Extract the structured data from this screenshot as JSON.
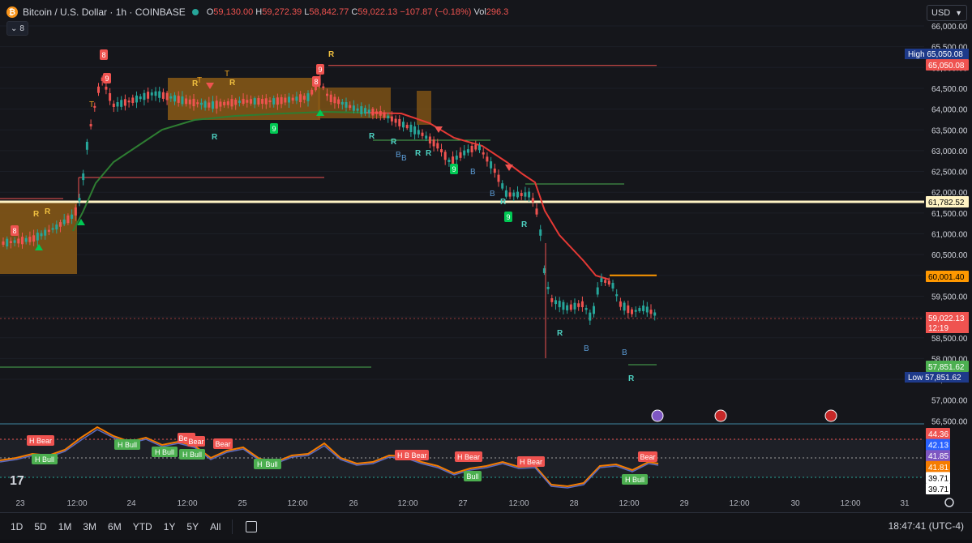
{
  "header": {
    "symbol_title": "Bitcoin / U.S. Dollar · 1h · COINBASE",
    "btc_glyph": "₿",
    "ohlc": [
      {
        "k": "O",
        "v": "59,130.00"
      },
      {
        "k": "H",
        "v": "59,272.39"
      },
      {
        "k": "L",
        "v": "58,842.77"
      },
      {
        "k": "C",
        "v": "59,022.13"
      },
      {
        "k": "",
        "v": "−107.87 (−0.18%)"
      },
      {
        "k": "Vol",
        "v": "296.3"
      }
    ],
    "indicator_count": "8",
    "currency": "USD"
  },
  "price_axis": {
    "ticks": [
      "66,000.00",
      "65,500.00",
      "65,000.00",
      "64,500.00",
      "64,000.00",
      "63,500.00",
      "63,000.00",
      "62,500.00",
      "62,000.00",
      "61,500.00",
      "61,000.00",
      "60,500.00",
      "60,000.00",
      "59,500.00",
      "59,000.00",
      "58,500.00",
      "58,000.00",
      "57,500.00",
      "57,000.00",
      "56,500.00"
    ],
    "high_label": "High",
    "high_value": "65,050.08",
    "high_line_value": "65,050.08",
    "level_value": "61,782.52",
    "resistance_value": "60,001.40",
    "last_price": "59,022.13",
    "countdown": "12:19",
    "support_value": "57,851.62",
    "low_label": "Low",
    "low_value": "57,851.62"
  },
  "osc_axis": {
    "values": [
      "44.36",
      "42.13",
      "41.85",
      "41.81",
      "39.71",
      "39.71"
    ],
    "colors": [
      "#ef5350",
      "#2962ff",
      "#7e57c2",
      "#f57c00",
      "#ffffff",
      "#ffffff"
    ]
  },
  "time_axis": {
    "labels": [
      "23",
      "12:00",
      "24",
      "12:00",
      "25",
      "12:00",
      "26",
      "12:00",
      "27",
      "12:00",
      "28",
      "12:00",
      "29",
      "12:00",
      "30",
      "12:00",
      "31"
    ]
  },
  "signals": {
    "eight": "8",
    "nine": "9",
    "R": "R",
    "T": "T",
    "B": "B",
    "H_Bear": "H Bear",
    "H_Bull": "H Bull",
    "Bear": "Bear",
    "Bull": "Bull"
  },
  "bottom": {
    "timeframes": [
      "1D",
      "5D",
      "1M",
      "3M",
      "6M",
      "YTD",
      "1Y",
      "5Y",
      "All"
    ],
    "clock": "18:47:41 (UTC-4)"
  },
  "colors": {
    "up": "#26a69a",
    "down": "#ef5350",
    "band": "#b8741a",
    "ema_green": "#2e7d32",
    "ema_red": "#e53935",
    "level": "#fff3c4"
  }
}
